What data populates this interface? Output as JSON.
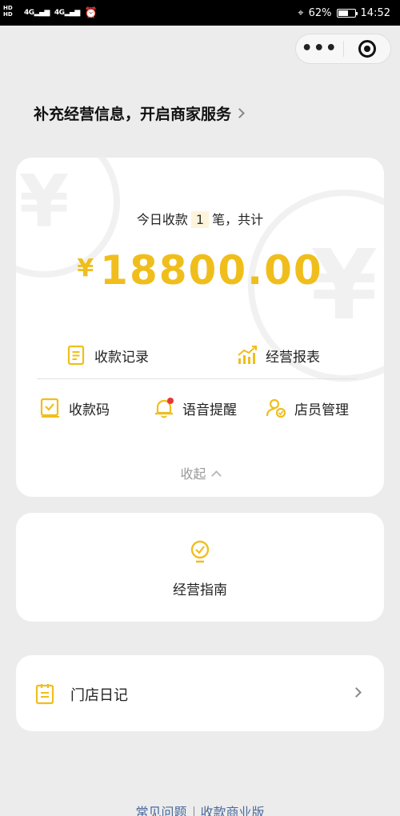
{
  "status_bar": {
    "hd": "HD",
    "signal": "4G",
    "battery_pct": "62%",
    "time": "14:52"
  },
  "capsule": {
    "more": "•••"
  },
  "info_link": "补充经营信息，开启商家服务",
  "today": {
    "prefix": "今日收款",
    "count": "1",
    "suffix": "笔，共计"
  },
  "amount": {
    "currency": "¥",
    "value": "18800.00"
  },
  "menu": {
    "records": "收款记录",
    "report": "经营报表",
    "qrcode": "收款码",
    "voice": "语音提醒",
    "staff": "店员管理"
  },
  "collapse_label": "收起",
  "guide_label": "经营指南",
  "diary_label": "门店日记",
  "footer": {
    "faq": "常见问题",
    "biz": "收款商业版"
  },
  "colors": {
    "accent": "#f0be1c",
    "badge": "#e53935",
    "link": "#4a6a9c"
  }
}
